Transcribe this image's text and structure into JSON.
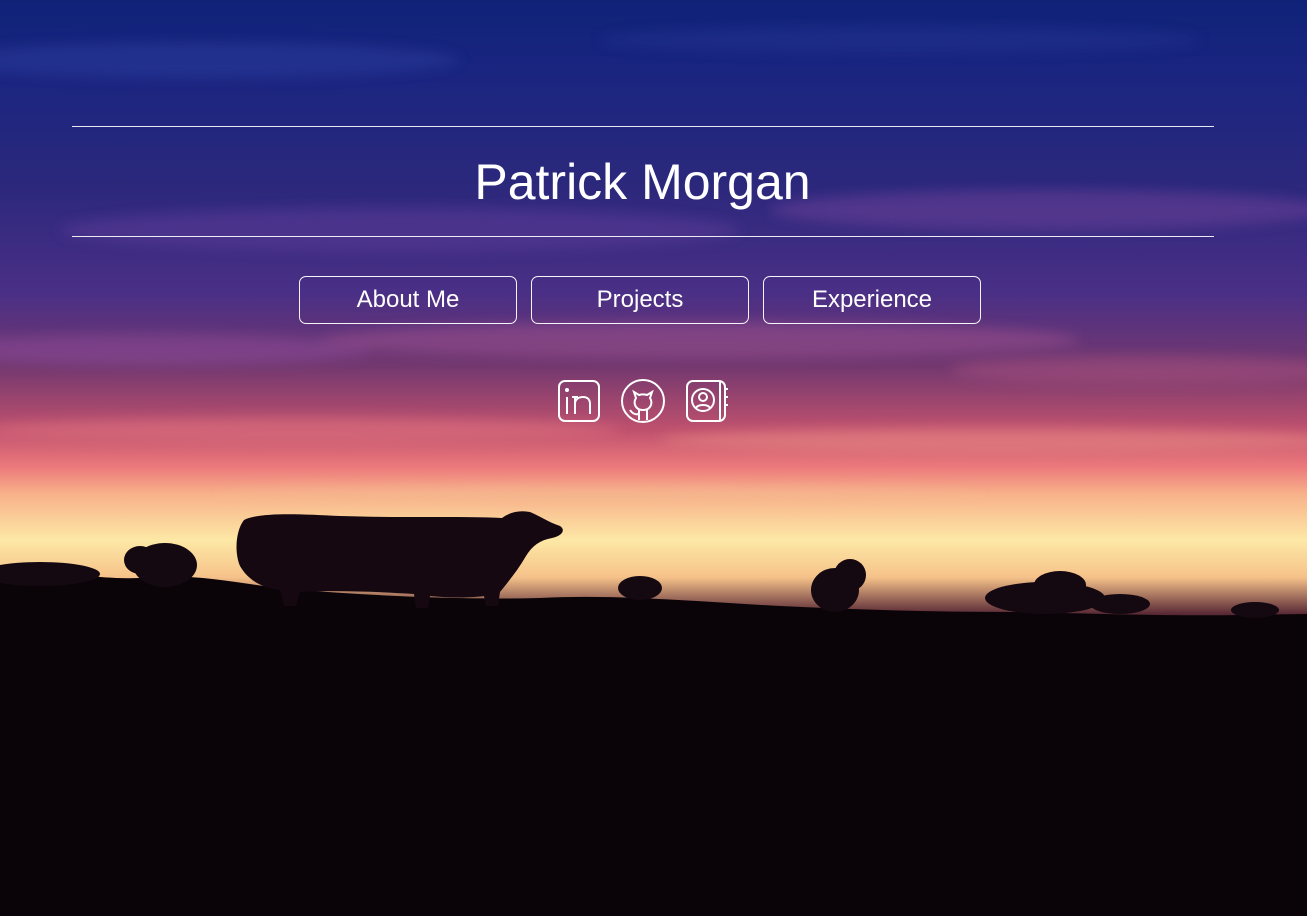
{
  "header": {
    "name": "Patrick Morgan"
  },
  "nav": {
    "items": [
      {
        "label": "About Me"
      },
      {
        "label": "Projects"
      },
      {
        "label": "Experience"
      }
    ]
  },
  "socials": [
    {
      "icon": "linkedin-icon"
    },
    {
      "icon": "github-icon"
    },
    {
      "icon": "contact-book-icon"
    }
  ],
  "colors": {
    "text": "#ffffff",
    "sky_top": "#0f2278",
    "sunset_glow": "#fde8a6",
    "ground": "#050307"
  }
}
